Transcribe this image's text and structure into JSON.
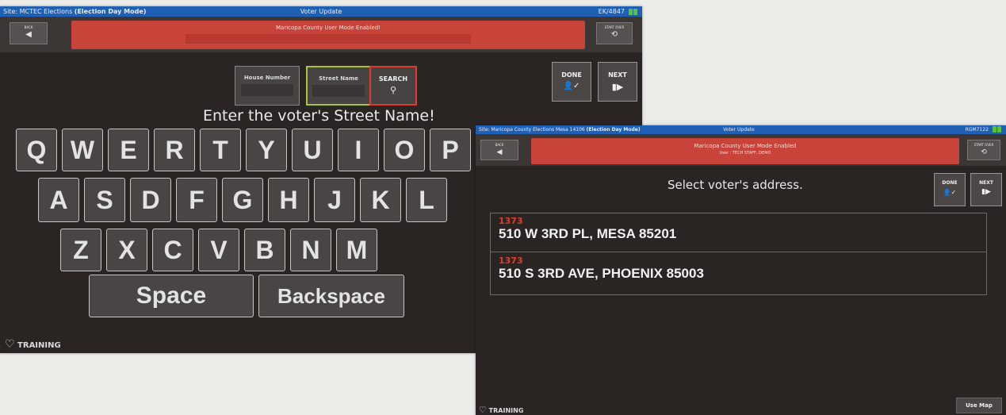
{
  "left_screen": {
    "titlebar": {
      "site_prefix": "Site: MCTEC Elections",
      "mode": "(Election Day Mode)",
      "title": "Voter Update",
      "device_id": "EK/4847"
    },
    "back_label": "BACK",
    "banner": "Maricopa County User Mode Enabled!",
    "start_over_label": "START OVER",
    "fields": {
      "house_number": "House Number",
      "street_name": "Street Name",
      "search": "SEARCH"
    },
    "done_label": "DONE",
    "next_label": "NEXT",
    "prompt": "Enter the voter's Street Name!",
    "keyboard": {
      "row1": [
        "Q",
        "W",
        "E",
        "R",
        "T",
        "Y",
        "U",
        "I",
        "O",
        "P"
      ],
      "row2": [
        "A",
        "S",
        "D",
        "F",
        "G",
        "H",
        "J",
        "K",
        "L"
      ],
      "row3": [
        "Z",
        "X",
        "C",
        "V",
        "B",
        "N",
        "M"
      ],
      "space": "Space",
      "backspace": "Backspace"
    },
    "training": "TRAINING"
  },
  "right_screen": {
    "titlebar": {
      "site_prefix": "Site: Maricopa County Elections Mesa 14106",
      "mode": "(Election Day Mode)",
      "title": "Voter Update",
      "device_id": "RGM7122"
    },
    "back_label": "BACK",
    "banner_line1": "Maricopa County User Mode Enabled",
    "banner_line2": "User : TECH STAFF, DEMO",
    "start_over_label": "START OVER",
    "prompt": "Select voter's address.",
    "done_label": "DONE",
    "next_label": "NEXT",
    "addresses": [
      {
        "number": "1373",
        "street": "510 W 3RD PL, MESA 85201"
      },
      {
        "number": "1373",
        "street": "510 S 3RD AVE, PHOENIX 85003"
      }
    ],
    "training": "TRAINING",
    "use_map": "Use Map"
  },
  "colors": {
    "titlebar": "#1f5fb4",
    "banner": "#c8443a",
    "screen_bg": "#2a2523",
    "street_field_highlight": "#a7c43a",
    "search_highlight": "#e23a2a",
    "precinct_number": "#e33b2e"
  },
  "icons": {
    "back": "back-icon",
    "start_over": "start-over-icon",
    "search": "magnifier-icon",
    "done": "person-check-icon",
    "next": "next-icon",
    "training": "lightbulb-icon"
  }
}
